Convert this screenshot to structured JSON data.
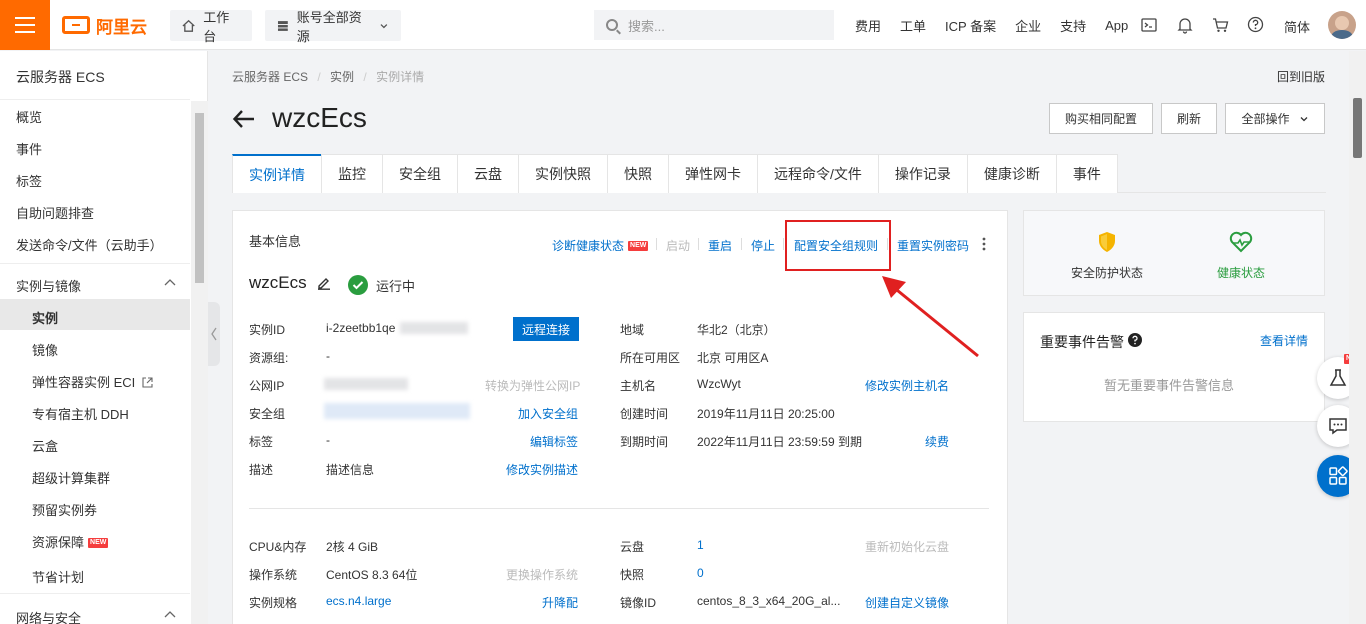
{
  "topbar": {
    "brand": "阿里云",
    "workbench": "工作台",
    "resources": "账号全部资源",
    "search_placeholder": "搜索...",
    "nav": [
      "费用",
      "工单",
      "ICP 备案",
      "企业",
      "支持",
      "App"
    ],
    "lang": "简体"
  },
  "sidebar": {
    "title": "云服务器 ECS",
    "top_items": [
      "概览",
      "事件",
      "标签",
      "自助问题排查",
      "发送命令/文件（云助手）"
    ],
    "group1": "实例与镜像",
    "group1_items": [
      "实例",
      "镜像",
      "弹性容器实例 ECI",
      "专有宿主机 DDH",
      "云盒",
      "超级计算集群",
      "预留实例券",
      "资源保障",
      "节省计划"
    ],
    "group2": "网络与安全",
    "new_badge": "NEW"
  },
  "breadcrumb": [
    "云服务器 ECS",
    "实例",
    "实例详情"
  ],
  "back_old": "回到旧版",
  "page_title": "wzcEcs",
  "header_buttons": {
    "buy_same": "购买相同配置",
    "refresh": "刷新",
    "all_actions": "全部操作"
  },
  "tabs": [
    "实例详情",
    "监控",
    "安全组",
    "云盘",
    "实例快照",
    "快照",
    "弹性网卡",
    "远程命令/文件",
    "操作记录",
    "健康诊断",
    "事件"
  ],
  "basic": {
    "title": "基本信息",
    "actions": {
      "diagnose": "诊断健康状态",
      "start": "启动",
      "restart": "重启",
      "stop": "停止",
      "config_sg": "配置安全组规则",
      "reset_pwd": "重置实例密码"
    },
    "instance_name": "wzcEcs",
    "status": "运行中",
    "fields_left": [
      {
        "k": "实例ID",
        "v": "i-2zeetbb1qe"
      },
      {
        "k": "资源组:",
        "v": "-"
      },
      {
        "k": "公网IP",
        "v": ""
      },
      {
        "k": "安全组",
        "v": ""
      },
      {
        "k": "标签",
        "v": "-"
      },
      {
        "k": "描述",
        "v": "描述信息"
      }
    ],
    "left_links": {
      "remote": "远程连接",
      "convert_eip": "转换为弹性公网IP",
      "add_sg": "加入安全组",
      "edit_tag": "编辑标签",
      "edit_desc": "修改实例描述"
    },
    "fields_right": [
      {
        "k": "地域",
        "v": "华北2（北京）"
      },
      {
        "k": "所在可用区",
        "v": "北京 可用区A"
      },
      {
        "k": "主机名",
        "v": "WzcWyt"
      },
      {
        "k": "创建时间",
        "v": "2019年11月11日 20:25:00"
      },
      {
        "k": "到期时间",
        "v": "2022年11月11日 23:59:59 到期"
      }
    ],
    "right_links": {
      "edit_host": "修改实例主机名",
      "renew": "续费"
    },
    "config_left": [
      {
        "k": "CPU&内存",
        "v": "2核 4 GiB"
      },
      {
        "k": "操作系统",
        "v": "CentOS 8.3 64位"
      },
      {
        "k": "实例规格",
        "v": "ecs.n4.large"
      }
    ],
    "config_left_links": {
      "change_os": "更换操作系统",
      "resize": "升降配"
    },
    "config_right": [
      {
        "k": "云盘",
        "v": "1"
      },
      {
        "k": "快照",
        "v": "0"
      },
      {
        "k": "镜像ID",
        "v": "centos_8_3_x64_20G_al..."
      }
    ],
    "config_right_links": {
      "reinit": "重新初始化云盘",
      "create_image": "创建自定义镜像"
    }
  },
  "status_card": {
    "security": "安全防护状态",
    "health": "健康状态"
  },
  "events_card": {
    "title": "重要事件告警",
    "link": "查看详情",
    "empty": "暂无重要事件告警信息"
  },
  "float_new": "NEW",
  "colors": {
    "brand": "#ff6a00",
    "link": "#0070cc",
    "running": "#2a9d3f",
    "highlight": "#e02020"
  }
}
